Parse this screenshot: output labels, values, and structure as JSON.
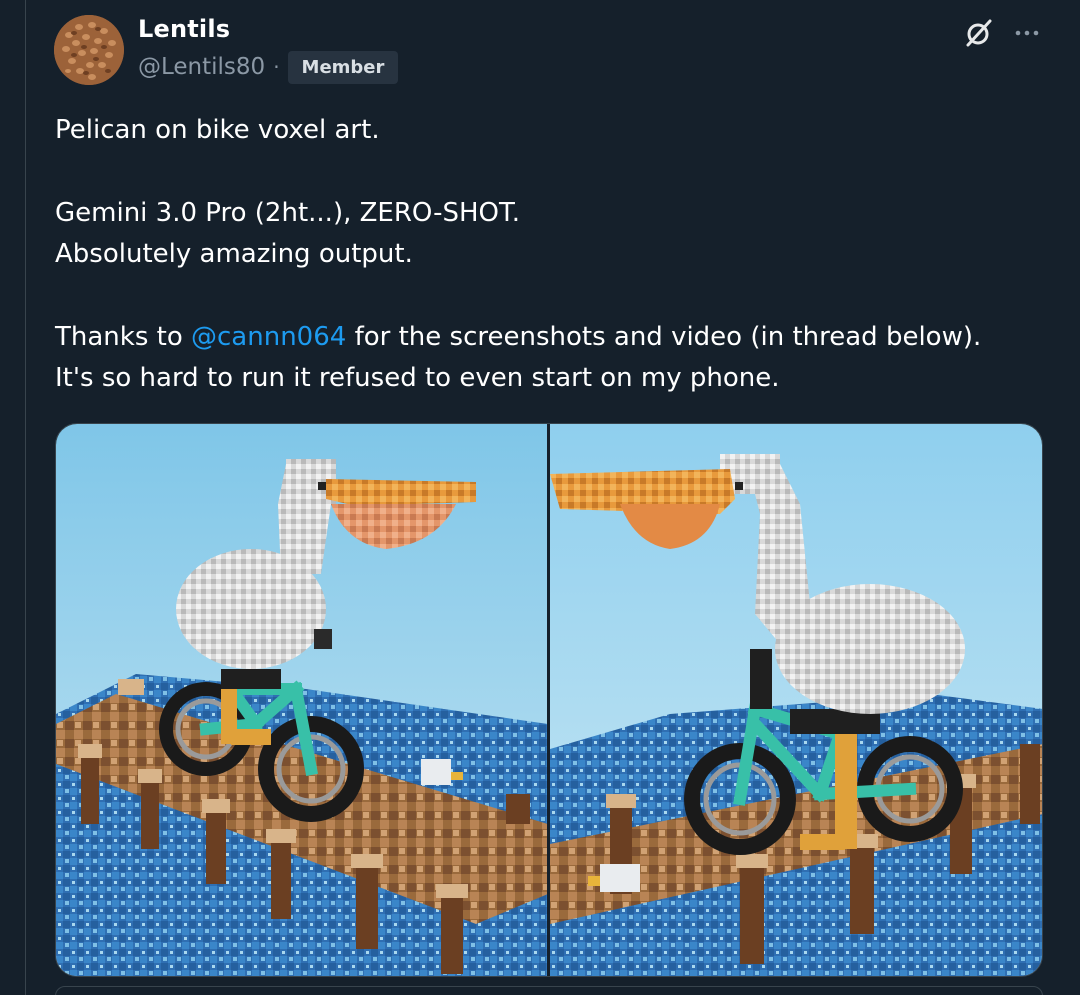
{
  "author": {
    "display_name": "Lentils",
    "handle": "@Lentils80",
    "separator": "·",
    "badge": "Member",
    "avatar_icon": "lentils-avatar"
  },
  "actions": {
    "grok_icon": "grok-icon",
    "more_icon": "more-icon"
  },
  "tweet": {
    "line1": "Pelican on bike voxel art.",
    "line2": "Gemini 3.0 Pro (2ht...), ZERO-SHOT.",
    "line3": "Absolutely amazing output.",
    "line4_prefix": "Thanks to ",
    "line4_mention": "@cannn064",
    "line4_suffix": " for the screenshots and video (in thread below).",
    "line5": "It's so hard to run it refused to even start on my phone."
  },
  "media": {
    "left_image": "voxel pelican on bicycle on pier, side view",
    "right_image": "voxel pelican on bicycle on pier, opposite side view"
  },
  "colors": {
    "background": "#15202b",
    "text": "#ffffff",
    "secondary_text": "#8b98a5",
    "link": "#1d9bf0",
    "border": "#38444d"
  }
}
